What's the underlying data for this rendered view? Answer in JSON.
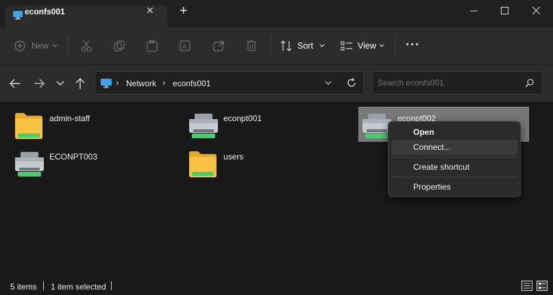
{
  "tab": {
    "title": "econfs001",
    "close": "✕",
    "new": "+"
  },
  "window": {
    "minimize": "—",
    "maximize": "☐",
    "close": "✕"
  },
  "toolbar": {
    "new_label": "New",
    "sort_label": "Sort",
    "view_label": "View",
    "more_label": "···"
  },
  "address": {
    "segments": [
      "Network",
      "econfs001"
    ]
  },
  "search": {
    "placeholder": "Search econfs001"
  },
  "items": [
    {
      "label": "admin-staff",
      "icon": "folder-icon"
    },
    {
      "label": "econpt001",
      "icon": "printer-icon"
    },
    {
      "label": "econpt002",
      "icon": "printer-icon"
    },
    {
      "label": "ECONPT003",
      "icon": "printer-icon"
    },
    {
      "label": "users",
      "icon": "folder-icon"
    }
  ],
  "context_menu": {
    "open": "Open",
    "connect": "Connect...",
    "create_shortcut": "Create shortcut",
    "properties": "Properties"
  },
  "status": {
    "count": "5 items",
    "selected": "1 item selected"
  },
  "colors": {
    "folder": "#f6c343",
    "printer_accent": "#3fd16a",
    "selection": "#777777"
  }
}
